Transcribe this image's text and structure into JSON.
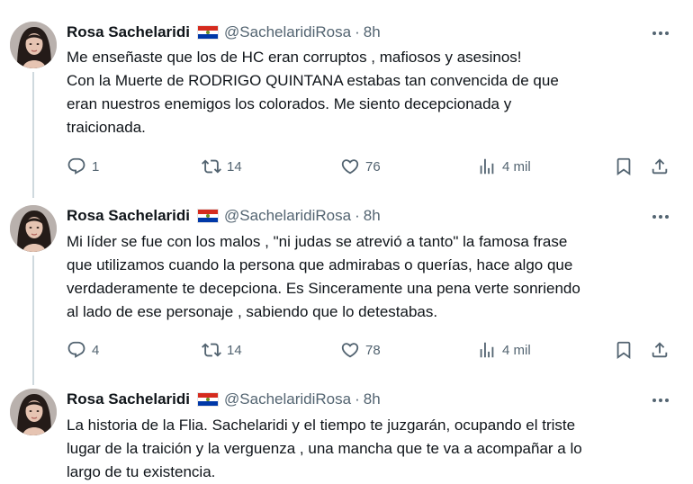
{
  "tweets": [
    {
      "author": "Rosa Sachelaridi",
      "handle": "@SachelaridiRosa",
      "separator": "·",
      "time": "8h",
      "lines": [
        "Me enseñaste que los de HC eran corruptos , mafiosos y asesinos!",
        "Con la Muerte de RODRIGO QUINTANA estabas tan convencida de que",
        "eran nuestros enemigos los colorados. Me siento decepcionada y",
        "traicionada."
      ],
      "replies": "1",
      "retweets": "14",
      "likes": "76",
      "views": "4 mil"
    },
    {
      "author": "Rosa Sachelaridi",
      "handle": "@SachelaridiRosa",
      "separator": "·",
      "time": "8h",
      "lines": [
        "Mi líder se fue con los malos , \"ni judas se atrevió a tanto\" la famosa frase",
        "que utilizamos cuando la persona que admirabas o querías, hace algo que",
        "verdaderamente te decepciona. Es Sinceramente una pena verte sonriendo",
        "al lado de ese personaje , sabiendo que lo detestabas."
      ],
      "replies": "4",
      "retweets": "14",
      "likes": "78",
      "views": "4 mil"
    },
    {
      "author": "Rosa Sachelaridi",
      "handle": "@SachelaridiRosa",
      "separator": "·",
      "time": "8h",
      "lines": [
        "La historia de la Flia. Sachelaridi y el tiempo te juzgarán, ocupando el triste",
        "lugar de la traición y la verguenza , una mancha que te va a  acompañar a lo",
        "largo de tu existencia."
      ]
    }
  ],
  "icons": {
    "reply": "reply-icon",
    "retweet": "retweet-icon",
    "like": "heart-icon",
    "views": "views-icon",
    "bookmark": "bookmark-icon",
    "share": "share-icon",
    "more": "more-icon",
    "flag": "paraguay-flag-icon"
  },
  "colors": {
    "text": "#0f1419",
    "secondary": "#536471",
    "thread_line": "#cfd9de"
  }
}
